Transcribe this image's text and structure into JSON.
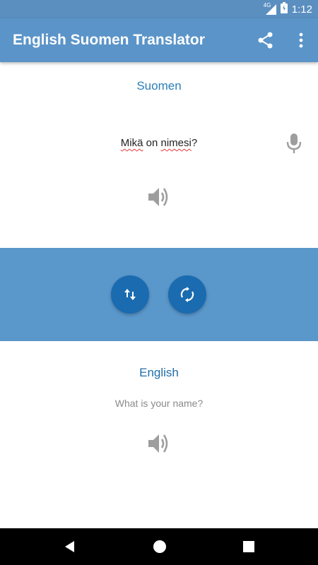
{
  "status_bar": {
    "network_label": "4G",
    "time": "1:12",
    "icons": [
      "signal-icon",
      "battery-icon"
    ]
  },
  "app_bar": {
    "title": "English Suomen Translator",
    "icons": [
      "share-icon",
      "more-vert-icon"
    ]
  },
  "source": {
    "language": "Suomen",
    "text_parts": [
      "Mikä",
      " on ",
      "nimesi",
      "?"
    ],
    "icons": [
      "mic-icon",
      "speaker-icon"
    ]
  },
  "controls": {
    "icons": [
      "swap-icon",
      "refresh-icon"
    ]
  },
  "target": {
    "language": "English",
    "text": "What is your name?",
    "icons": [
      "speaker-icon"
    ]
  },
  "nav_bar": {
    "icons": [
      "back-icon",
      "home-icon",
      "recents-icon"
    ]
  },
  "colors": {
    "app_bar": "#5b94c8",
    "status_bar": "#5a8fc0",
    "middle_band": "#5a97cb",
    "round_button": "#1a6bb0",
    "source_language": "#2a7fb8",
    "target_language": "#1f6ea8",
    "icon_gray": "#9e9e9e"
  }
}
